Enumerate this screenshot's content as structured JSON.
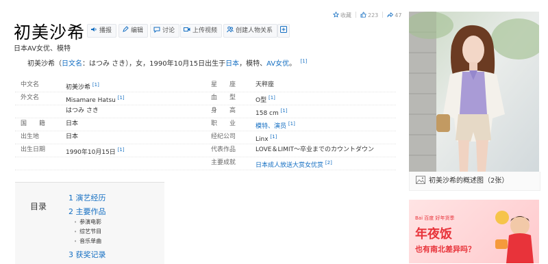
{
  "header": {
    "title": "初美沙希",
    "actions": [
      "播报",
      "编辑",
      "讨论",
      "上传视频",
      "创建人物关系"
    ],
    "collect_label": "收藏",
    "like_count": "223",
    "share_count": "47"
  },
  "subtitle": "日本AV女优、模特",
  "summary": {
    "name": "初美沙希",
    "paren_open": "（",
    "jp_label": "日文名",
    "jp_value": "：はつみ さき",
    "paren_close": "），女，1990年10月15日出生于",
    "country": "日本",
    "mid": "，模特、",
    "job": "AV女优",
    "end": "。",
    "ref": "[1]"
  },
  "info_rows": [
    {
      "label": "中文名",
      "value": "初美沙希",
      "ref": "[1]",
      "label2": "星　　座",
      "value2": "天秤座",
      "ref2": ""
    },
    {
      "label": "外文名",
      "value": "Misamare Hatsu",
      "ref": "[1]",
      "label2": "血　　型",
      "value2": "O型",
      "ref2": "[1]"
    },
    {
      "label": "",
      "value": "はつみ さき",
      "ref": "",
      "label2": "身　　高",
      "value2": "158 cm",
      "ref2": "[1]"
    },
    {
      "label": "国　　籍",
      "value": "日本",
      "ref": "",
      "label2": "职　　业",
      "value2": "模特、演员",
      "ref2": "[1]"
    },
    {
      "label": "出生地",
      "value": "日本",
      "ref": "",
      "label2": "经纪公司",
      "value2": "Linx",
      "ref2": "[1]"
    },
    {
      "label": "出生日期",
      "value": "1990年10月15日",
      "ref": "[1]",
      "label2": "代表作品",
      "value2": "LOVE＆LIMIT～卒业までのカウントダウン",
      "ref2": ""
    },
    {
      "label": "",
      "value": "",
      "ref": "",
      "label2": "主要成就",
      "value2": "日本成人放送大赏女优赏",
      "ref2": "[2]"
    }
  ],
  "toc": {
    "label": "目录",
    "items": [
      "1  演艺经历",
      "2  主要作品",
      "3  获奖记录"
    ],
    "subitems": [
      "参演电影",
      "综艺节目",
      "音乐单曲"
    ]
  },
  "image_caption": "初美沙希的概述图（2张）",
  "ad": {
    "brand": "Bai 百度",
    "brand_tag": "好年货季",
    "headline": "年夜饭",
    "subline": "也有南北差异吗？"
  },
  "colors": {
    "link": "#136ec2",
    "ad_red": "#e8333a",
    "ad_bg": "#ffd6d8"
  }
}
